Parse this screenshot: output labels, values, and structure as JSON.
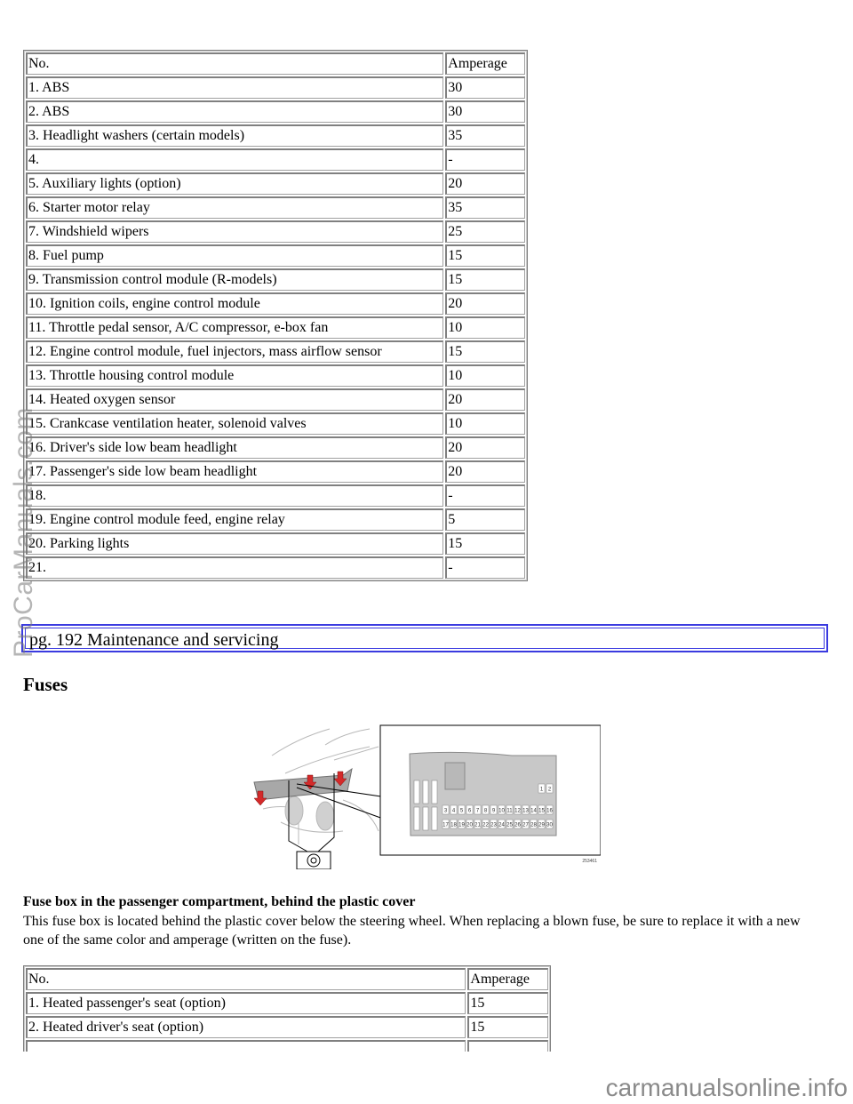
{
  "table1": {
    "headers": [
      "No.",
      "Amperage"
    ],
    "rows": [
      {
        "no": "1. ABS",
        "amp": "30"
      },
      {
        "no": "2. ABS",
        "amp": "30"
      },
      {
        "no": "3. Headlight washers (certain models)",
        "amp": "35"
      },
      {
        "no": "4.",
        "amp": "-"
      },
      {
        "no": "5. Auxiliary lights (option)",
        "amp": "20"
      },
      {
        "no": "6. Starter motor relay",
        "amp": "35"
      },
      {
        "no": "7. Windshield wipers",
        "amp": "25"
      },
      {
        "no": "8. Fuel pump",
        "amp": "15"
      },
      {
        "no": "9. Transmission control module (R-models)",
        "amp": "15"
      },
      {
        "no": "10. Ignition coils, engine control module",
        "amp": "20"
      },
      {
        "no": "11. Throttle pedal sensor, A/C compressor, e-box fan",
        "amp": "10"
      },
      {
        "no": "12. Engine control module, fuel injectors, mass airflow sensor",
        "amp": "15"
      },
      {
        "no": "13. Throttle housing control module",
        "amp": "10"
      },
      {
        "no": "14. Heated oxygen sensor",
        "amp": "20"
      },
      {
        "no": "15. Crankcase ventilation heater, solenoid valves",
        "amp": "10"
      },
      {
        "no": "16. Driver's side low beam headlight",
        "amp": "20"
      },
      {
        "no": "17. Passenger's side low beam headlight",
        "amp": "20"
      },
      {
        "no": "18.",
        "amp": "-"
      },
      {
        "no": "19. Engine control module feed, engine relay",
        "amp": "5"
      },
      {
        "no": "20. Parking lights",
        "amp": "15"
      },
      {
        "no": "21.",
        "amp": "-"
      }
    ]
  },
  "page_header": "pg. 192 Maintenance and servicing",
  "section_title": "Fuses",
  "figure": {
    "fuse_labels_row1": [
      "3",
      "4",
      "5",
      "6",
      "7",
      "8",
      "9",
      "10",
      "11",
      "12",
      "13",
      "14",
      "15",
      "16"
    ],
    "fuse_labels_row2": [
      "17",
      "18",
      "19",
      "20",
      "21",
      "22",
      "23",
      "24",
      "25",
      "26",
      "27",
      "28",
      "29",
      "30"
    ],
    "fuse_labels_top": [
      "1",
      "2"
    ],
    "figure_code": "253461"
  },
  "caption": "Fuse box in the passenger compartment, behind the plastic cover",
  "paragraph": "This fuse box is located behind the plastic cover below the steering wheel. When replacing a blown fuse, be sure to replace it with a new one of the same color and amperage (written on the fuse).",
  "table2": {
    "headers": [
      "No.",
      "Amperage"
    ],
    "rows": [
      {
        "no": "1. Heated passenger's seat (option)",
        "amp": "15"
      },
      {
        "no": "2. Heated driver's seat (option)",
        "amp": "15"
      },
      {
        "no": "",
        "amp": ""
      }
    ]
  },
  "watermarks": {
    "left": "ProCarManuals.com",
    "bottom": "carmanualsonline.info"
  }
}
